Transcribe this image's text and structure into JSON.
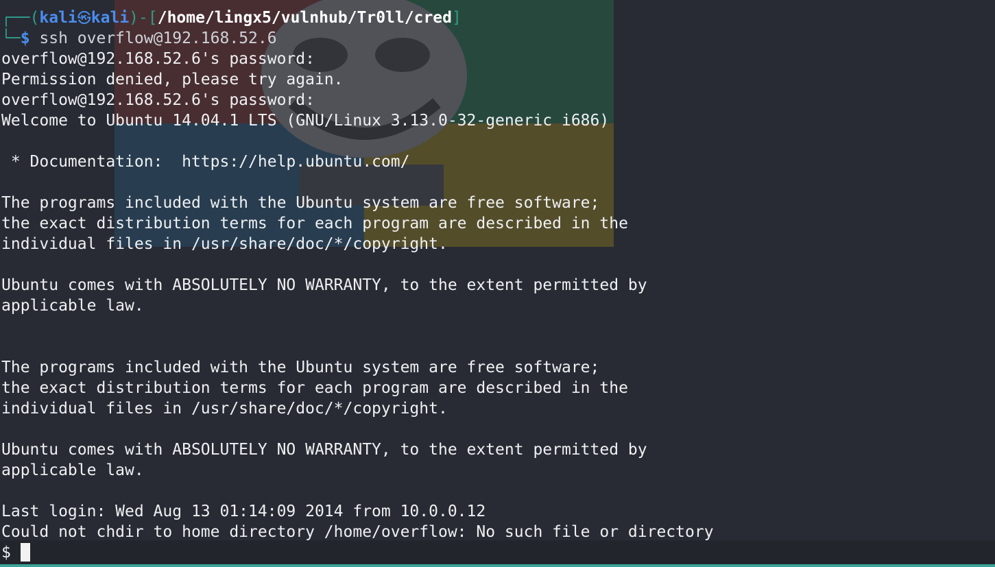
{
  "prompt": {
    "frame_open": "┌──(",
    "user": "kali",
    "skull_icon": "㉿",
    "host": "kali",
    "frame_mid": ")-[",
    "cwd": "/home/lingx5/vulnhub/Tr0ll/cred",
    "frame_close": "]",
    "frame_bottom": "└─",
    "dollar": "$",
    "command": " ssh overflow@192.168.52.6"
  },
  "output": [
    "overflow@192.168.52.6's password:",
    "Permission denied, please try again.",
    "overflow@192.168.52.6's password:",
    "Welcome to Ubuntu 14.04.1 LTS (GNU/Linux 3.13.0-32-generic i686)",
    "",
    " * Documentation:  https://help.ubuntu.com/",
    "",
    "The programs included with the Ubuntu system are free software;",
    "the exact distribution terms for each program are described in the",
    "individual files in /usr/share/doc/*/copyright.",
    "",
    "Ubuntu comes with ABSOLUTELY NO WARRANTY, to the extent permitted by",
    "applicable law.",
    "",
    "",
    "The programs included with the Ubuntu system are free software;",
    "the exact distribution terms for each program are described in the",
    "individual files in /usr/share/doc/*/copyright.",
    "",
    "Ubuntu comes with ABSOLUTELY NO WARRANTY, to the extent permitted by",
    "applicable law.",
    "",
    "Last login: Wed Aug 13 01:14:09 2014 from 10.0.0.12",
    "Could not chdir to home directory /home/overflow: No such file or directory"
  ],
  "remote_prompt": "$",
  "colors": {
    "background": "#282b33",
    "prompt_blue": "#4a8df0",
    "frame_teal": "#2f9b8c",
    "text": "#eef0f2"
  }
}
